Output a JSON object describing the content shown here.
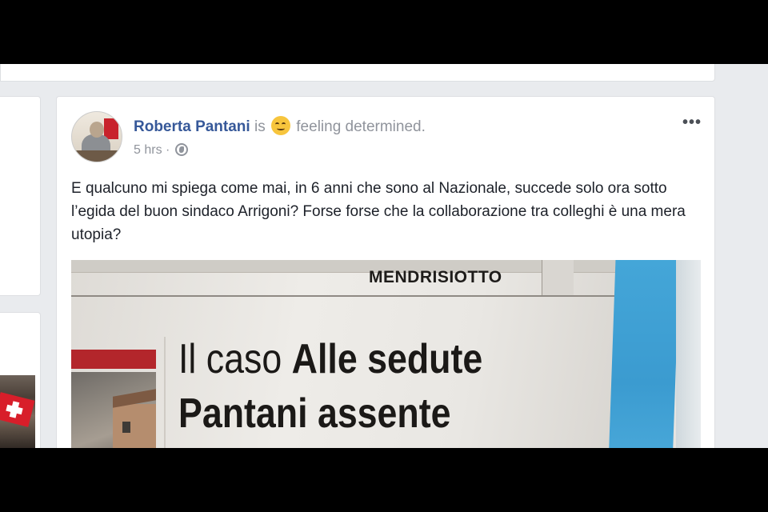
{
  "post": {
    "author": "Roberta Pantani",
    "is_text": "is",
    "feeling": "feeling determined.",
    "time": "5 hrs",
    "separator": "·",
    "more": "•••",
    "text": "E qualcuno mi spiega come mai, in 6 anni che sono al Nazionale, succede solo ora sotto l’egida del buon sindaco Arrigoni? Forse forse che la collaborazione tra colleghi è una mera utopia?",
    "photo": {
      "section": "MENDRISIOTTO",
      "headline_light": "Il caso",
      "headline_bold": "Alle sedute",
      "headline_line2": "Pantani assente"
    }
  },
  "icons": {
    "feeling": "grin-emoji-icon",
    "privacy": "globe-icon",
    "menu": "more-options-icon"
  },
  "colors": {
    "author_link": "#365899",
    "meta": "#90949c",
    "feed_background": "#e9ebee"
  }
}
